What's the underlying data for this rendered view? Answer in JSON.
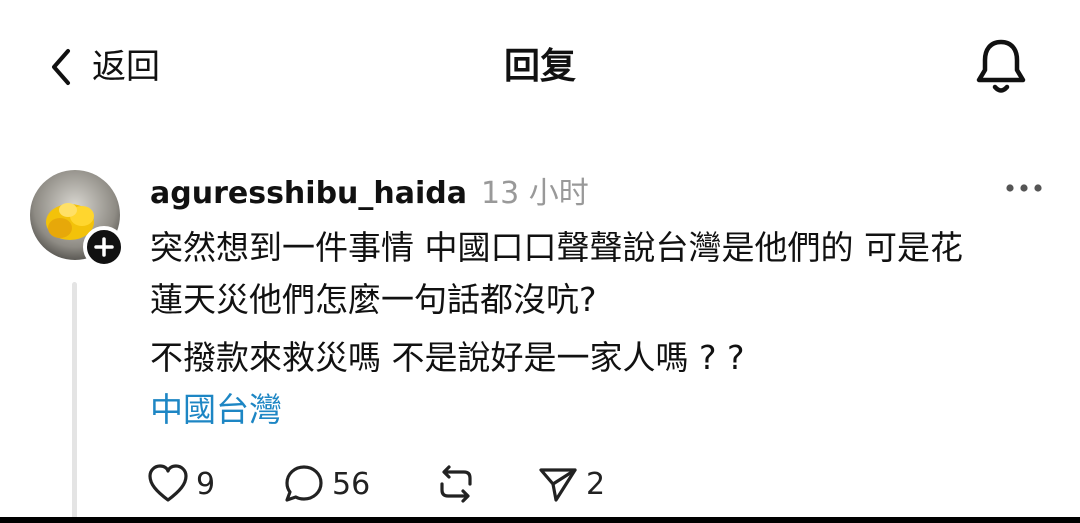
{
  "header": {
    "back_label": "返回",
    "title": "回复",
    "back_icon": "chevron-left-icon",
    "bell_icon": "bell-icon"
  },
  "post": {
    "username": "aguresshibu_haida",
    "time": "13 小时",
    "line1": "突然想到一件事情 中國口口聲聲說台灣是他們的 可是花",
    "line2": "蓮天災他們怎麼一句話都沒吭?",
    "line3": "不撥款來救災嗎 不是說好是一家人嗎 ? ?",
    "tag": "中國台灣",
    "tag_color": "#1d86c4",
    "more_icon": "more-horizontal-icon",
    "avatar_icon": "avatar-image"
  },
  "actions": {
    "likes": "9",
    "comments": "56",
    "shares": "2",
    "like_icon": "heart-icon",
    "comment_icon": "comment-icon",
    "repost_icon": "repost-icon",
    "send_icon": "send-icon"
  }
}
